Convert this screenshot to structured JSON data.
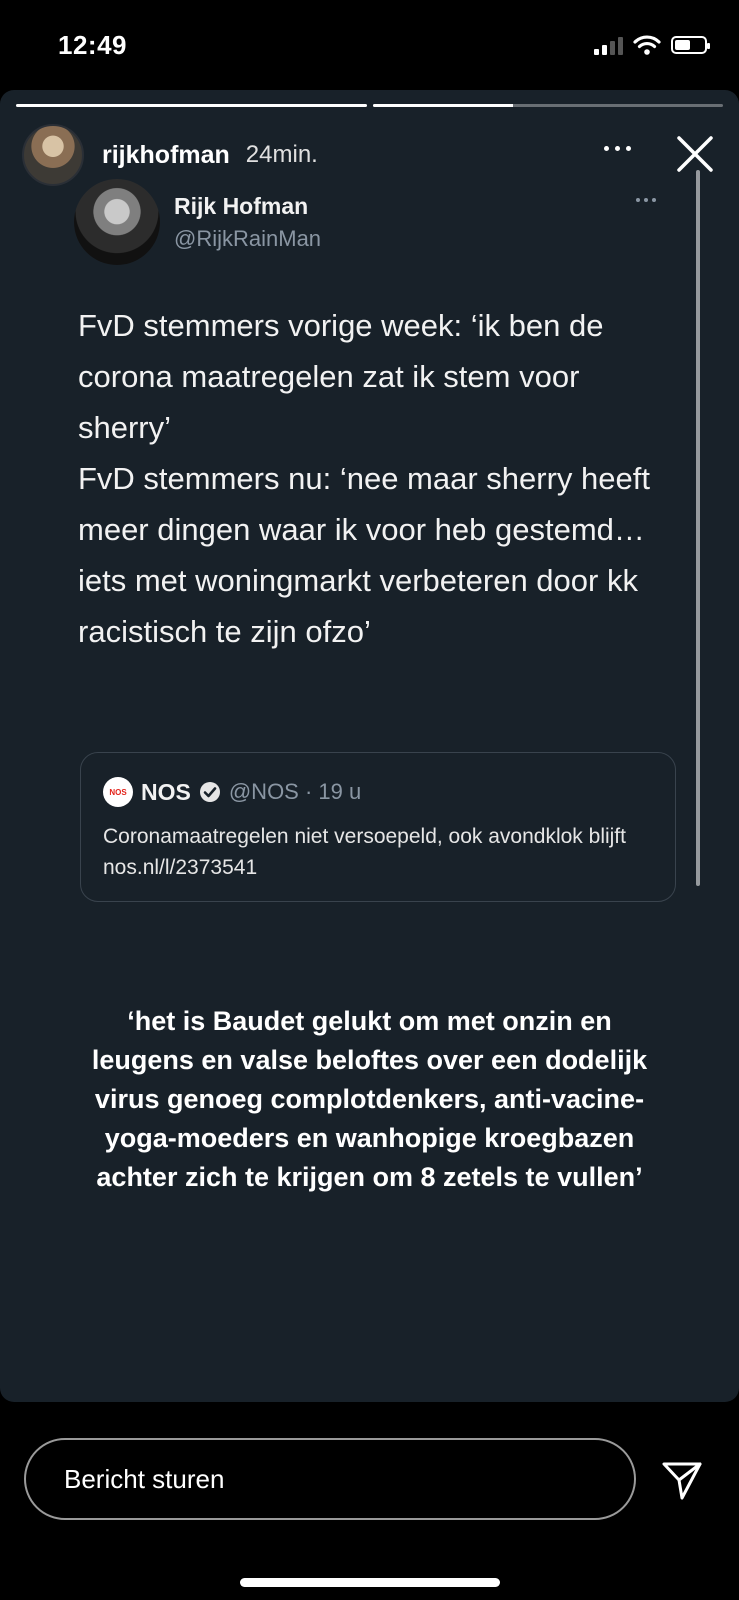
{
  "status_bar": {
    "time": "12:49",
    "signal_icon": "signal-icon",
    "wifi_icon": "wifi-icon",
    "battery_icon": "battery-icon"
  },
  "story": {
    "progress": [
      1.0,
      0.4
    ],
    "header": {
      "username": "rijkhofman",
      "time_ago": "24min.",
      "more_icon": "more-icon",
      "close_icon": "close-icon"
    },
    "tweet": {
      "name": "Rijk Hofman",
      "handle": "@RijkRainMan",
      "text": "FvD stemmers vorige week: ‘ik ben de corona maatregelen zat ik stem voor sherry’\nFvD stemmers nu: ‘nee maar sherry heeft meer dingen waar ik voor heb gestemd… iets met woningmarkt verbeteren door kk racistisch te zijn ofzo’",
      "quote": {
        "logo_text": "NOS",
        "name": "NOS",
        "handle_time": "@NOS · 19 u",
        "text": "Coronamaatregelen niet versoepeld, ook avondklok blijft  nos.nl/l/2373541"
      }
    },
    "caption": "‘het is Baudet gelukt om met onzin en\nleugens en valse beloftes over een dodelijk\nvirus genoeg complotdenkers, anti-vacine-\nyoga-moeders en wanhopige kroegbazen\nachter zich te krijgen om 8 zetels te vullen’"
  },
  "reply": {
    "placeholder": "Bericht sturen",
    "send_icon": "send-icon"
  },
  "colors": {
    "story_background": "#182129",
    "handle_gray": "#8a96a3",
    "nos_red": "#e3231b"
  }
}
